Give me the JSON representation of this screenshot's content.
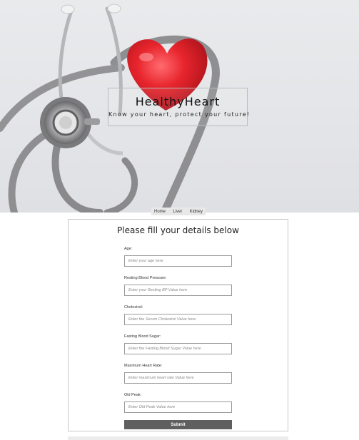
{
  "hero": {
    "brand": "HealthyHeart",
    "tagline": "Know your heart, protect your future!"
  },
  "nav": {
    "items": [
      "Home",
      "Liver",
      "Kidney"
    ]
  },
  "form": {
    "heading": "Please fill your details below",
    "fields": [
      {
        "label": "Age:",
        "placeholder": "Enter your age here"
      },
      {
        "label": "Resting Blood Pressure:",
        "placeholder": "Enter your Resting BP Value here"
      },
      {
        "label": "Cholestrol:",
        "placeholder": "Enter the Serum Cholestrol Value here"
      },
      {
        "label": "Fasting Blood Sugar:",
        "placeholder": "Enter the Fasting Blood Sugar Value here"
      },
      {
        "label": "Maximum Heart Rate:",
        "placeholder": "Enter maximum heart rate Value here"
      },
      {
        "label": "Old Peak:",
        "placeholder": "Enter Old Peak Value here"
      }
    ],
    "submit_label": "Submit"
  },
  "colors": {
    "heart": "#e2262f",
    "submit_bg": "#5f5f5f",
    "stethoscope": "#8d8d8f"
  }
}
